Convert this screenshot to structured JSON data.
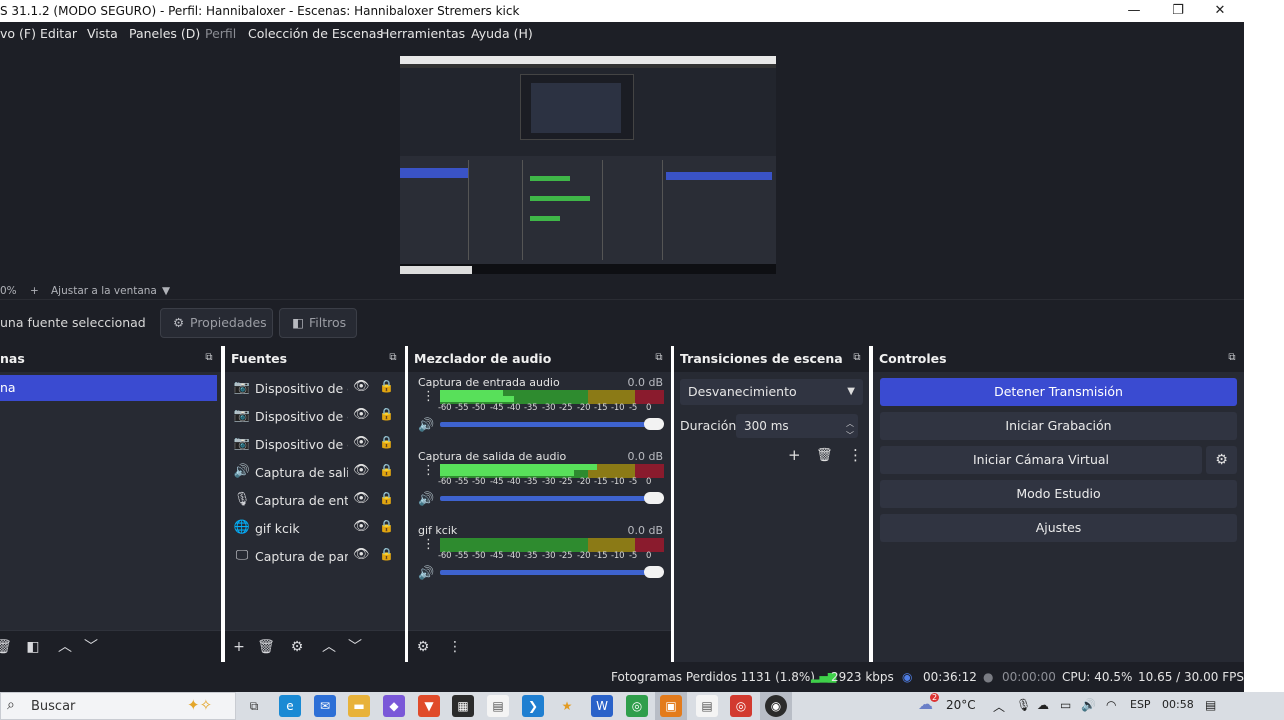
{
  "window": {
    "title": "S 31.1.2 (MODO SEGURO) - Perfil: Hannibaloxer - Escenas: Hannibaloxer Stremers kick",
    "minimize": "—",
    "maximize": "❐",
    "close": "✕"
  },
  "menu": {
    "items": [
      "vo (F)",
      "Editar",
      "Vista",
      "Paneles (D)",
      "Perfil",
      "Colección de Escenas",
      "Herramientas",
      "Ayuda (H)"
    ]
  },
  "preview_toolbar": {
    "zoom": "0%",
    "plus": "+",
    "fit": "Ajustar a la ventana",
    "dropdown": "▼"
  },
  "context": {
    "no_source": "una fuente seleccionad",
    "properties": "Propiedades",
    "filters": "Filtros"
  },
  "scenes": {
    "title": "nas",
    "items": [
      "na"
    ]
  },
  "sources": {
    "title": "Fuentes",
    "items": [
      {
        "name": "Dispositivo de captura de video",
        "icon": "camera-icon"
      },
      {
        "name": "Dispositivo de captura de video",
        "icon": "camera-icon"
      },
      {
        "name": "Dispositivo de captura de video",
        "icon": "camera-icon"
      },
      {
        "name": "Captura de salida de audio",
        "icon": "speaker-icon"
      },
      {
        "name": "Captura de entrada de audio",
        "icon": "microphone-icon"
      },
      {
        "name": "gif kcik",
        "icon": "globe-icon"
      },
      {
        "name": "Captura de pantalla",
        "icon": "monitor-icon"
      }
    ]
  },
  "mixer": {
    "title": "Mezclador de audio",
    "ticks": [
      "-60",
      "-55",
      "-50",
      "-45",
      "-40",
      "-35",
      "-30",
      "-25",
      "-20",
      "-15",
      "-10",
      "-5",
      "0"
    ],
    "channels": [
      {
        "name": "Captura de entrada audio",
        "db": "0.0 dB",
        "level": 0.28,
        "level2": 0.33
      },
      {
        "name": "Captura de salida de audio",
        "db": "0.0 dB",
        "level": 0.7,
        "level2": 0.6
      },
      {
        "name": "gif kcik",
        "db": "0.0 dB",
        "level": 0.0,
        "level2": 0.0
      }
    ]
  },
  "transitions": {
    "title": "Transiciones de escena",
    "selected": "Desvanecimiento",
    "duration_label": "Duración",
    "duration_value": "300 ms"
  },
  "controls": {
    "title": "Controles",
    "stop_stream": "Detener Transmisión",
    "start_recording": "Iniciar Grabación",
    "virtual_camera": "Iniciar Cámara Virtual",
    "studio_mode": "Modo Estudio",
    "settings": "Ajustes"
  },
  "status": {
    "dropped_frames": "Fotogramas Perdidos 1131 (1.8%)",
    "bitrate": "2923 kbps",
    "stream_time": "00:36:12",
    "record_time": "00:00:00",
    "cpu": "CPU: 40.5%",
    "fps": "10.65 / 30.00 FPS"
  },
  "taskbar": {
    "search_placeholder": "Buscar",
    "weather": "20°C",
    "weather_badge": "2",
    "language": "ESP",
    "time": "00:58"
  },
  "colors": {
    "accent": "#3a4bd1",
    "panel": "#272a33",
    "background": "#1d1f26",
    "meter_green": "#2e8b2f",
    "meter_yellow": "#8b7a16",
    "meter_red": "#8a1b2d"
  }
}
